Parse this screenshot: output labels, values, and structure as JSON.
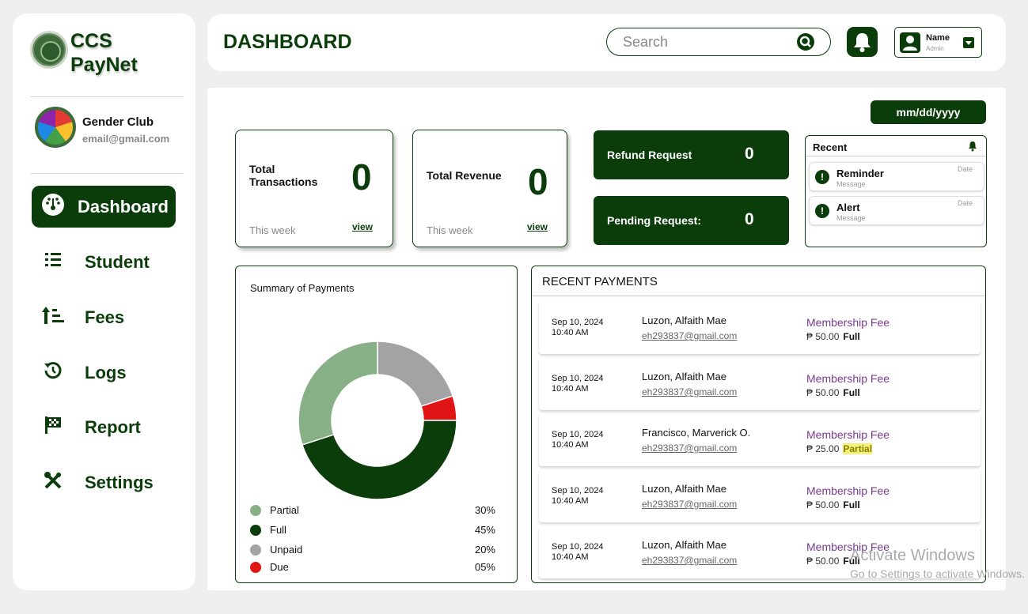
{
  "app": {
    "brand_line1": "CCS",
    "brand_line2": "PayNet"
  },
  "profile": {
    "name": "Gender Club",
    "email": "email@gmail.com"
  },
  "sidebar": {
    "items": [
      {
        "label": "Dashboard",
        "icon": "dashboard-icon",
        "active": true
      },
      {
        "label": "Student",
        "icon": "list-icon"
      },
      {
        "label": "Fees",
        "icon": "sort-icon"
      },
      {
        "label": "Logs",
        "icon": "history-icon"
      },
      {
        "label": "Report",
        "icon": "flag-icon"
      },
      {
        "label": "Settings",
        "icon": "tools-icon"
      }
    ]
  },
  "header": {
    "title": "DASHBOARD",
    "search_placeholder": "Search",
    "user_name": "Name",
    "user_role": "Admin"
  },
  "colors": {
    "primary": "#0b3d0b",
    "fee": "#7b3b91",
    "partial_bg": "#f4f17a"
  },
  "date_filter": "mm/dd/yyyy",
  "stats": {
    "total_transactions": {
      "label_line1": "Total",
      "label_line2": "Transactions",
      "value": "0",
      "period": "This week",
      "link": "view"
    },
    "total_revenue": {
      "label": "Total Revenue",
      "value": "0",
      "period": "This week",
      "link": "view"
    }
  },
  "requests": {
    "refund": {
      "label": "Refund Request",
      "value": "0"
    },
    "pending": {
      "label": "Pending Request:",
      "value": "0"
    }
  },
  "recent": {
    "title": "Recent",
    "items": [
      {
        "title": "Reminder",
        "message": "Message",
        "date": "Date"
      },
      {
        "title": "Alert",
        "message": "Message",
        "date": "Date"
      }
    ]
  },
  "summary": {
    "title": "Summary of Payments"
  },
  "chart_data": {
    "type": "pie",
    "donut": true,
    "title": "Summary of Payments",
    "categories": [
      "Partial",
      "Full",
      "Unpaid",
      "Due"
    ],
    "values": [
      30,
      45,
      20,
      5
    ],
    "labels": [
      "30%",
      "45%",
      "20%",
      "05%"
    ],
    "colors": [
      "#88b086",
      "#0b3d0b",
      "#a3a3a3",
      "#e01414"
    ]
  },
  "payments": {
    "title": "RECENT PAYMENTS",
    "rows": [
      {
        "date": "Sep 10, 2024",
        "time": "10:40 AM",
        "name": "Luzon, Alfaith Mae",
        "email": "eh293837@gmail.com",
        "fee": "Membership Fee",
        "amount": "₱ 50.00",
        "status": "Full"
      },
      {
        "date": "Sep 10, 2024",
        "time": "10:40 AM",
        "name": "Luzon, Alfaith Mae",
        "email": "eh293837@gmail.com",
        "fee": "Membership Fee",
        "amount": "₱ 50.00",
        "status": "Full"
      },
      {
        "date": "Sep 10, 2024",
        "time": "10:40 AM",
        "name": "Francisco, Marverick O.",
        "email": "eh293837@gmail.com",
        "fee": "Membership Fee",
        "amount": "₱ 25.00",
        "status": "Partial"
      },
      {
        "date": "Sep 10, 2024",
        "time": "10:40 AM",
        "name": "Luzon, Alfaith Mae",
        "email": "eh293837@gmail.com",
        "fee": "Membership Fee",
        "amount": "₱ 50.00",
        "status": "Full"
      },
      {
        "date": "Sep 10, 2024",
        "time": "10:40 AM",
        "name": "Luzon, Alfaith Mae",
        "email": "eh293837@gmail.com",
        "fee": "Membership Fee",
        "amount": "₱ 50.00",
        "status": "Full"
      }
    ]
  },
  "os_watermark": {
    "line1": "Activate Windows",
    "line2": "Go to Settings to activate Windows."
  }
}
